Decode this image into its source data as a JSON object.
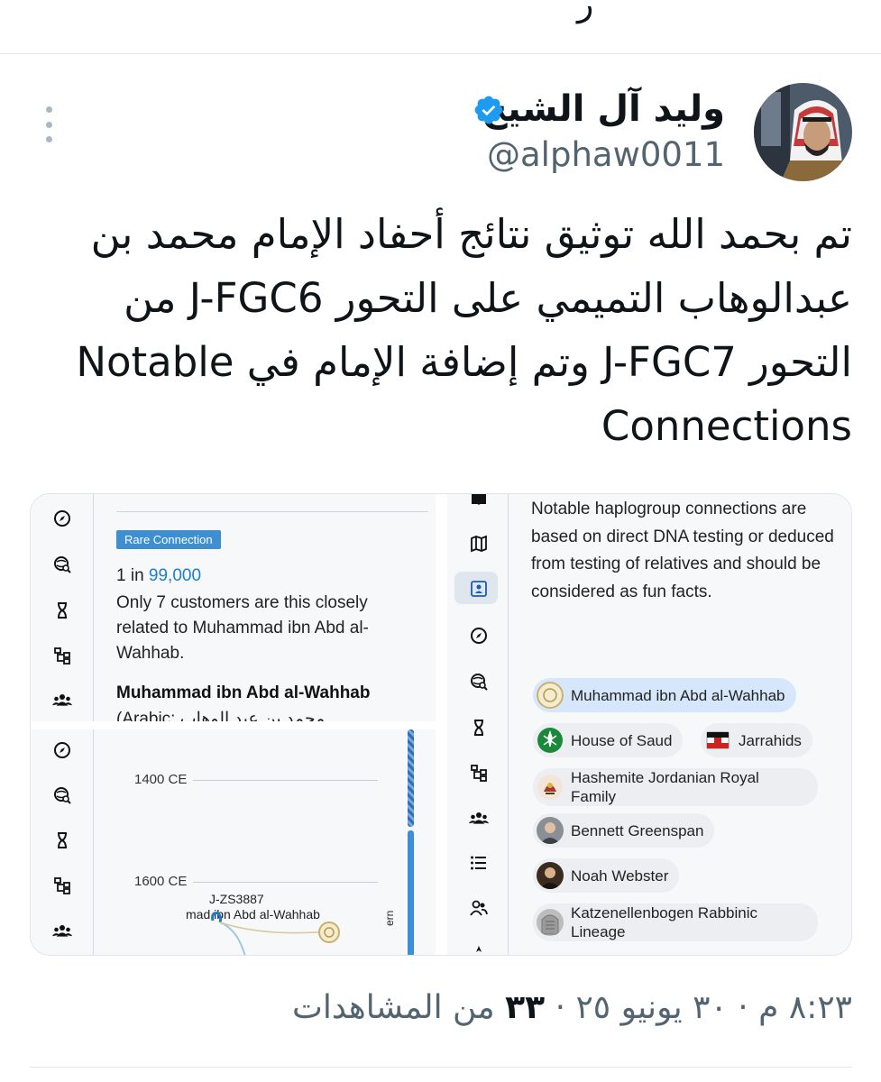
{
  "colors": {
    "verified_blue": "#1d9bf0",
    "text_primary": "#0f1419",
    "text_secondary": "#536471",
    "badge_blue": "#3d8fd1",
    "highlight_blue": "#1d7fc4",
    "chip_selected": "#d7e7fb"
  },
  "previous_tweet": {
    "fragment": "ر"
  },
  "tweet": {
    "author": {
      "display_name": "وليد آل الشيخ",
      "handle": "@alphaw0011",
      "verified_icon": "verified-badge-icon"
    },
    "text_lines": [
      "تم بحمد الله توثيق نتائج أحفاد الإمام محمد بن",
      "عبدالوهاب التميمي على التحور J-FGC6 من",
      "التحور J-FGC7 وتم إضافة الإمام في  Notable",
      "Connections"
    ],
    "timestamp": "٨:٢٣ م · ٣٠ يونيو ٢٥",
    "views_count": "٣٣",
    "views_label": "من المشاهدات"
  },
  "media": {
    "connection_card": {
      "badge": "Rare Connection",
      "odds_prefix": "1 in ",
      "odds_value": "99,000",
      "description": "Only 7 customers are this closely related to Muhammad ibn Abd al-Wahhab.",
      "person_name": "Muhammad ibn Abd al-Wahhab",
      "person_sub": "(Arabic: محمد بن عبد الوهاب"
    },
    "timeline": {
      "ticks": [
        "1400 CE",
        "1600 CE"
      ],
      "haplogroup": "J-ZS3887",
      "person_label": "mad ibn Abd al-Wahhab",
      "vertical_label": "ern"
    },
    "notable_panel": {
      "intro": "Notable haplogroup connections are based on direct DNA testing or deduced from testing of relatives and should be considered as fun facts.",
      "chips": [
        "Muhammad ibn Abd al-Wahhab",
        "House of Saud",
        "Jarrahids",
        "Hashemite Jordanian Royal Family",
        "Bennett Greenspan",
        "Noah Webster",
        "Katzenellenbogen Rabbinic Lineage"
      ]
    },
    "rail_icons_a": [
      "compass-icon",
      "globe-search-icon",
      "hourglass-icon",
      "tree-icon",
      "group-icon"
    ],
    "rail_icons_b": [
      "compass-icon",
      "globe-search-icon",
      "hourglass-icon",
      "tree-icon",
      "group-icon"
    ],
    "rail_icons_c": [
      "book-icon",
      "map-icon",
      "profile-card-icon",
      "compass-icon",
      "globe-search-icon",
      "hourglass-icon",
      "tree-icon",
      "group-icon",
      "list-icon",
      "people-icon",
      "more-icon"
    ]
  }
}
